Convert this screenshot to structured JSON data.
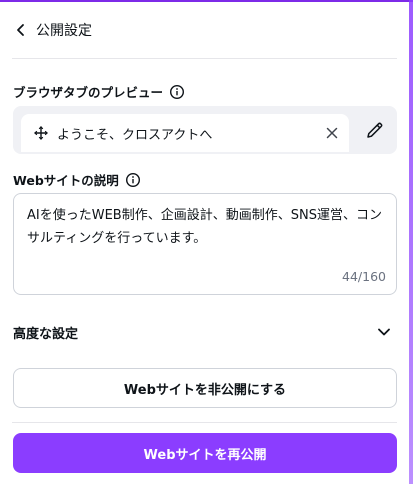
{
  "header": {
    "back_icon": "chevron-left-icon",
    "title": "公開設定"
  },
  "browser_tab_preview": {
    "label": "ブラウザタブのプレビュー",
    "info_icon": "info-icon",
    "favicon": "move-icon",
    "tab_title": "ようこそ、クロスアクトへ",
    "close_icon": "close-icon",
    "edit_icon": "pencil-icon"
  },
  "description": {
    "label": "Webサイトの説明",
    "info_icon": "info-icon",
    "value": "AIを使ったWEB制作、企画設計、動画制作、SNS運営、コンサルティングを行っています。",
    "char_count": "44/160"
  },
  "advanced": {
    "label": "高度な設定",
    "chevron_icon": "chevron-down-icon"
  },
  "buttons": {
    "unpublish_label": "Webサイトを非公開にする",
    "republish_label": "Webサイトを再公開"
  },
  "colors": {
    "accent": "#8b3dff",
    "accent_text": "#ffffff",
    "border": "#cfd3da",
    "muted_text": "#6b7280"
  }
}
